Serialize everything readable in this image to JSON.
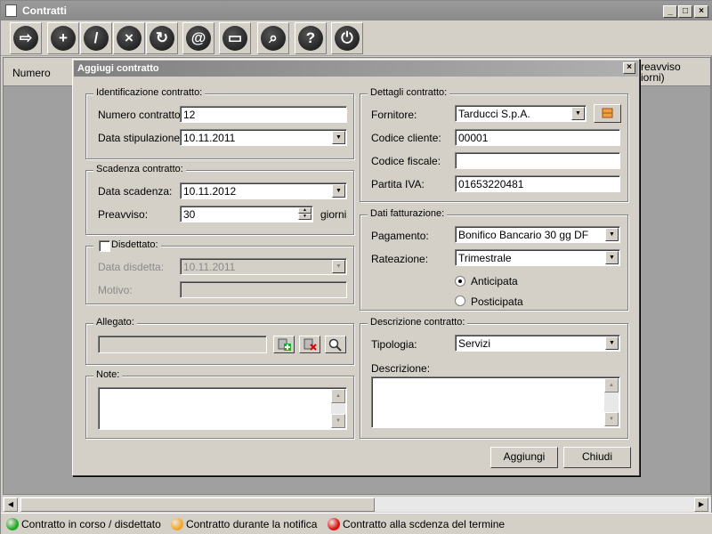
{
  "window": {
    "title": "Contratti",
    "min": "_",
    "max": "□",
    "close": "×"
  },
  "toolbar": {
    "buttons": [
      {
        "name": "exit",
        "glyph": "⇨"
      },
      {
        "name": "add",
        "glyph": "+"
      },
      {
        "name": "edit",
        "glyph": "/"
      },
      {
        "name": "delete",
        "glyph": "×"
      },
      {
        "name": "refresh",
        "glyph": "↻"
      },
      {
        "name": "email",
        "glyph": "@"
      },
      {
        "name": "print",
        "glyph": "▭"
      },
      {
        "name": "search",
        "glyph": "⌕"
      },
      {
        "name": "help",
        "glyph": "?"
      },
      {
        "name": "power",
        "glyph": "⏻"
      }
    ]
  },
  "list": {
    "col_numero": "Numero",
    "col_preavviso_1": "reavviso",
    "col_preavviso_2": "iorni)"
  },
  "status": {
    "item1": {
      "text": "Contratto in corso / disdettato",
      "color": "#22aa22"
    },
    "item2": {
      "text": "Contratto durante la notifica",
      "color": "#f5a623"
    },
    "item3": {
      "text": "Contratto alla scdenza del termine",
      "color": "#dd1111"
    }
  },
  "dialog": {
    "title": "Aggiugi contratto",
    "close": "×",
    "identificazione": {
      "legend": "Identificazione contratto:",
      "numero_label": "Numero contratto:",
      "numero_value": "12",
      "data_label": "Data stipulazione:",
      "data_value": "10.11.2011"
    },
    "scadenza": {
      "legend": "Scadenza contratto:",
      "data_label": "Data scadenza:",
      "data_value": "10.11.2012",
      "preavviso_label": "Preavviso:",
      "preavviso_value": "30",
      "unit": "giorni"
    },
    "disdetta": {
      "legend": "Disdettato:",
      "checked": false,
      "data_label": "Data disdetta:",
      "data_value": "10.11.2011",
      "motivo_label": "Motivo:",
      "motivo_value": ""
    },
    "allegato": {
      "legend": "Allegato:",
      "value": ""
    },
    "note": {
      "legend": "Note:",
      "value": ""
    },
    "dettagli": {
      "legend": "Dettagli contratto:",
      "fornitore_label": "Fornitore:",
      "fornitore_value": "Tarducci S.p.A.",
      "codcliente_label": "Codice cliente:",
      "codcliente_value": "00001",
      "codfiscale_label": "Codice fiscale:",
      "codfiscale_value": "",
      "piva_label": "Partita IVA:",
      "piva_value": "01653220481"
    },
    "fatturazione": {
      "legend": "Dati fatturazione:",
      "pagamento_label": "Pagamento:",
      "pagamento_value": "Bonifico Bancario 30 gg DF",
      "rateazione_label": "Rateazione:",
      "rateazione_value": "Trimestrale",
      "radio1": "Anticipata",
      "radio2": "Posticipata",
      "selected": "Anticipata"
    },
    "descrizione": {
      "legend": "Descrizione contratto:",
      "tipologia_label": "Tipologia:",
      "tipologia_value": "Servizi",
      "descrizione_label": "Descrizione:",
      "descrizione_value": ""
    },
    "buttons": {
      "aggiungi": "Aggiungi",
      "chiudi": "Chiudi"
    }
  }
}
